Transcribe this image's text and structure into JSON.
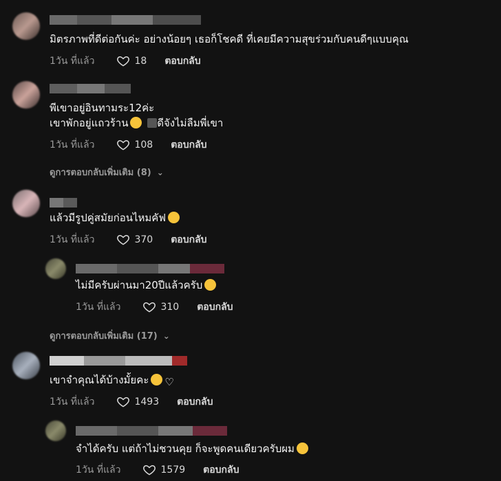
{
  "comments": [
    {
      "text": "มิตรภาพที่ดีต่อกันค่ะ อย่างน้อยๆ เธอก็โชคดี ที่เคยมีความสุขร่วมกับคนดีๆแบบคุณ",
      "time": "1วัน ที่แล้ว",
      "likes": "18",
      "reply": "ตอบกลับ"
    },
    {
      "text_line1": "พีเขาอยู่อินทามระ12ค่ะ",
      "text_line2": "เขาพักอยู่แถวร้าน",
      "text_line2_tail": "ดีจังไม่ลืมพี่เขา",
      "time": "1วัน ที่แล้ว",
      "likes": "108",
      "reply": "ตอบกลับ",
      "more": "ดูการตอบกลับเพิ่มเติม (8)"
    },
    {
      "text": "แล้วมีรูปคู่สมัยก่อนไหมคัฟ",
      "time": "1วัน ที่แล้ว",
      "likes": "370",
      "reply": "ตอบกลับ",
      "reply_item": {
        "text": "ไม่มีครับผ่านมา20ปีแล้วครับ",
        "time": "1วัน ที่แล้ว",
        "likes": "310",
        "reply": "ตอบกลับ"
      },
      "more": "ดูการตอบกลับเพิ่มเติม (17)"
    },
    {
      "text": "เขาจำคุณได้บ้างมั้ยคะ",
      "time": "1วัน ที่แล้ว",
      "likes": "1493",
      "reply": "ตอบกลับ",
      "reply_item": {
        "text": "จำได้ครับ แต่ถ้าไม่ชวนคุย ก็จะพูดคนเดียวครับผม",
        "time": "1วัน ที่แล้ว",
        "likes": "1579",
        "reply": "ตอบกลับ"
      }
    }
  ],
  "icons": {
    "like": "heart-outline-icon",
    "chevron": "chevron-down-icon"
  },
  "colors": {
    "background": "#121212",
    "muted": "#9a9a9a",
    "text": "#f5f5f5"
  }
}
